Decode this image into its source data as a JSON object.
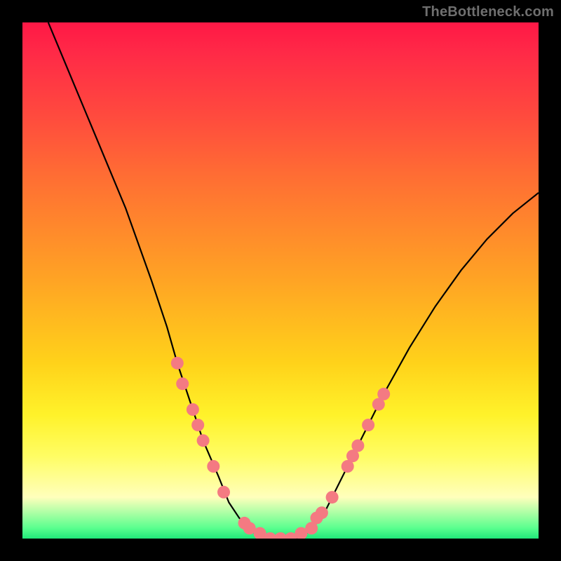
{
  "watermark": "TheBottleneck.com",
  "chart_data": {
    "type": "line",
    "title": "",
    "xlabel": "",
    "ylabel": "",
    "xlim": [
      0,
      100
    ],
    "ylim": [
      0,
      100
    ],
    "series": [
      {
        "name": "curve",
        "x": [
          5,
          10,
          15,
          20,
          25,
          28,
          30,
          33,
          35,
          38,
          40,
          42,
          45,
          48,
          50,
          53,
          55,
          58,
          60,
          65,
          70,
          75,
          80,
          85,
          90,
          95,
          100
        ],
        "y": [
          100,
          88,
          76,
          64,
          50,
          41,
          34,
          25,
          19,
          12,
          7,
          4,
          1,
          0,
          0,
          0,
          1,
          4,
          8,
          18,
          28,
          37,
          45,
          52,
          58,
          63,
          67
        ]
      }
    ],
    "markers": [
      {
        "x": 30,
        "y": 34
      },
      {
        "x": 31,
        "y": 30
      },
      {
        "x": 33,
        "y": 25
      },
      {
        "x": 34,
        "y": 22
      },
      {
        "x": 35,
        "y": 19
      },
      {
        "x": 37,
        "y": 14
      },
      {
        "x": 39,
        "y": 9
      },
      {
        "x": 43,
        "y": 3
      },
      {
        "x": 44,
        "y": 2
      },
      {
        "x": 46,
        "y": 1
      },
      {
        "x": 48,
        "y": 0
      },
      {
        "x": 50,
        "y": 0
      },
      {
        "x": 52,
        "y": 0
      },
      {
        "x": 54,
        "y": 1
      },
      {
        "x": 56,
        "y": 2
      },
      {
        "x": 57,
        "y": 4
      },
      {
        "x": 58,
        "y": 5
      },
      {
        "x": 60,
        "y": 8
      },
      {
        "x": 63,
        "y": 14
      },
      {
        "x": 64,
        "y": 16
      },
      {
        "x": 65,
        "y": 18
      },
      {
        "x": 67,
        "y": 22
      },
      {
        "x": 69,
        "y": 26
      },
      {
        "x": 70,
        "y": 28
      }
    ],
    "marker_color": "#f47a82",
    "curve_color": "#000000"
  }
}
